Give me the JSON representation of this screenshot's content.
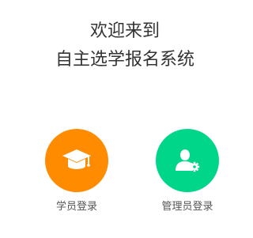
{
  "welcome": {
    "line1": "欢迎来到",
    "line2": "自主选学报名系统"
  },
  "roles": [
    {
      "label": "学员登录",
      "icon": "graduation-cap-icon",
      "color": "#ff8c00"
    },
    {
      "label": "管理员登录",
      "icon": "admin-user-gear-icon",
      "color": "#00d68a"
    }
  ]
}
